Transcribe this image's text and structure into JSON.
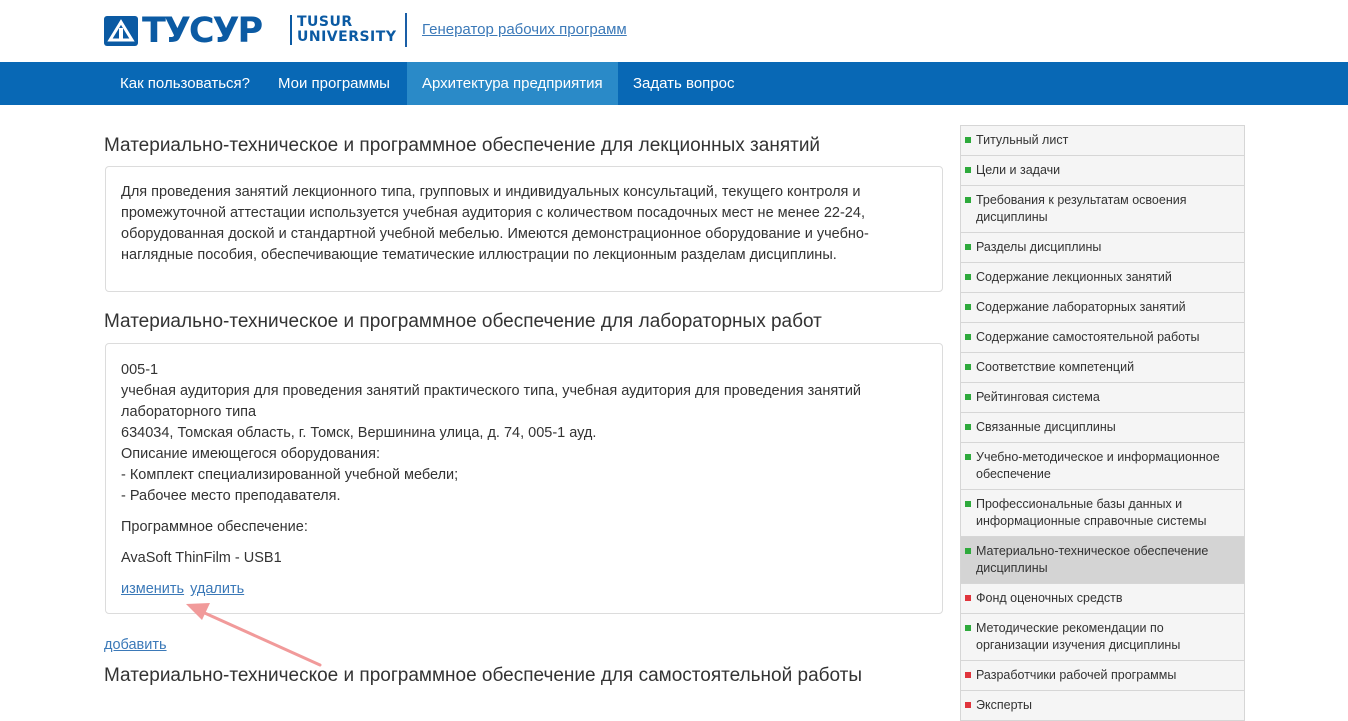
{
  "header": {
    "logo_text": "ТУСУР",
    "logo_sub_line1": "TUSUR",
    "logo_sub_line2": "UNIVERSITY",
    "app_link": "Генератор рабочих программ",
    "brand_color": "#0868b5"
  },
  "nav": [
    {
      "label": "Как пользоваться?",
      "active": false
    },
    {
      "label": "Мои программы",
      "active": false
    },
    {
      "label": "Архитектура предприятия",
      "active": true
    },
    {
      "label": "Задать вопрос",
      "active": false
    }
  ],
  "sections": {
    "lecture": {
      "title": "Материально-техническое и программное обеспечение для лекционных занятий",
      "text": "Для проведения занятий лекционного типа, групповых и индивидуальных консультаций, текущего контроля и промежуточной аттестации используется учебная аудитория с количеством посадочных мест не менее 22-24, оборудованная доской и стандартной учебной мебелью. Имеются демонстрационное оборудование и учебно-наглядные пособия, обеспечивающие тематические иллюстрации по лекционным разделам дисциплины."
    },
    "lab": {
      "title": "Материально-техническое и программное обеспечение для лабораторных работ",
      "room": "005-1",
      "description": "учебная аудитория для проведения занятий практического типа, учебная аудитория для проведения занятий лабораторного типа",
      "address": "634034, Томская область, г. Томск, Вершинина улица, д. 74, 005-1 ауд.",
      "equipment_heading": "Описание имеющегося оборудования:",
      "equipment": [
        "- Комплект специализированной учебной мебели;",
        "- Рабочее место преподавателя."
      ],
      "software_heading": "Программное обеспечение:",
      "software": "AvaSoft ThinFilm - USB1",
      "edit_link": "изменить",
      "delete_link": "удалить"
    },
    "add_link": "добавить",
    "self": {
      "title": "Материально-техническое и программное обеспечение для самостоятельной работы"
    }
  },
  "sidebar": {
    "items": [
      {
        "label": "Титульный лист",
        "status": "green"
      },
      {
        "label": "Цели и задачи",
        "status": "green"
      },
      {
        "label": "Требования к результатам освоения дисциплины",
        "status": "green"
      },
      {
        "label": "Разделы дисциплины",
        "status": "green"
      },
      {
        "label": "Содержание лекционных занятий",
        "status": "green"
      },
      {
        "label": "Содержание лабораторных занятий",
        "status": "green"
      },
      {
        "label": "Содержание самостоятельной работы",
        "status": "green"
      },
      {
        "label": "Соответствие компетенций",
        "status": "green"
      },
      {
        "label": "Рейтинговая система",
        "status": "green"
      },
      {
        "label": "Связанные дисциплины",
        "status": "green"
      },
      {
        "label": "Учебно-методическое и информационное обеспечение",
        "status": "green"
      },
      {
        "label": "Профессиональные базы данных и информационные справочные системы",
        "status": "green"
      },
      {
        "label": "Материально-техническое обеспечение дисциплины",
        "status": "green",
        "active": true
      },
      {
        "label": "Фонд оценочных средств",
        "status": "red"
      },
      {
        "label": "Методические рекомендации по организации изучения дисциплины",
        "status": "green"
      },
      {
        "label": "Разработчики рабочей программы",
        "status": "red"
      },
      {
        "label": "Эксперты",
        "status": "red"
      }
    ],
    "status_colors": {
      "green": "#2eaa3c",
      "red": "#e0343c"
    }
  },
  "annotation": {
    "arrow_color": "#f19a9a"
  }
}
